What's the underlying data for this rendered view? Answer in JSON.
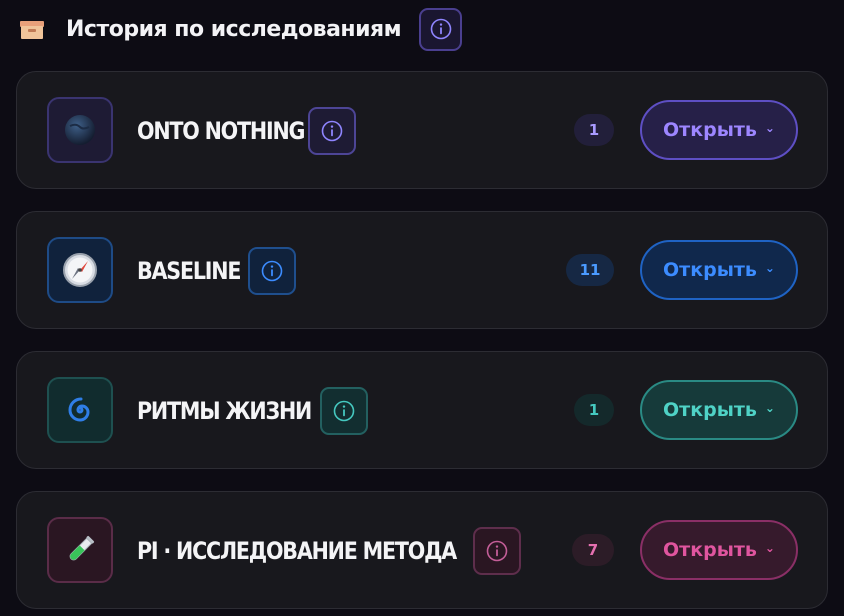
{
  "header": {
    "title": "История по исследованиям",
    "icon": "box-icon",
    "info_icon": "info-icon"
  },
  "cards": [
    {
      "title": "ONTO NOTHING",
      "icon": "planet-icon",
      "count": "1",
      "open_label": "Открыть",
      "accent": "#9d86ff"
    },
    {
      "title": "BASELINE",
      "icon": "compass-icon",
      "count": "11",
      "open_label": "Открыть",
      "accent": "#3c8cff"
    },
    {
      "title": "РИТМЫ ЖИЗНИ",
      "icon": "cyclone-icon",
      "count": "1",
      "open_label": "Открыть",
      "accent": "#4fd2c6"
    },
    {
      "title": "PI · ИССЛЕДОВАНИЕ МЕТОДА",
      "icon": "test-tube-icon",
      "count": "7",
      "open_label": "Открыть",
      "accent": "#e0559f"
    }
  ]
}
